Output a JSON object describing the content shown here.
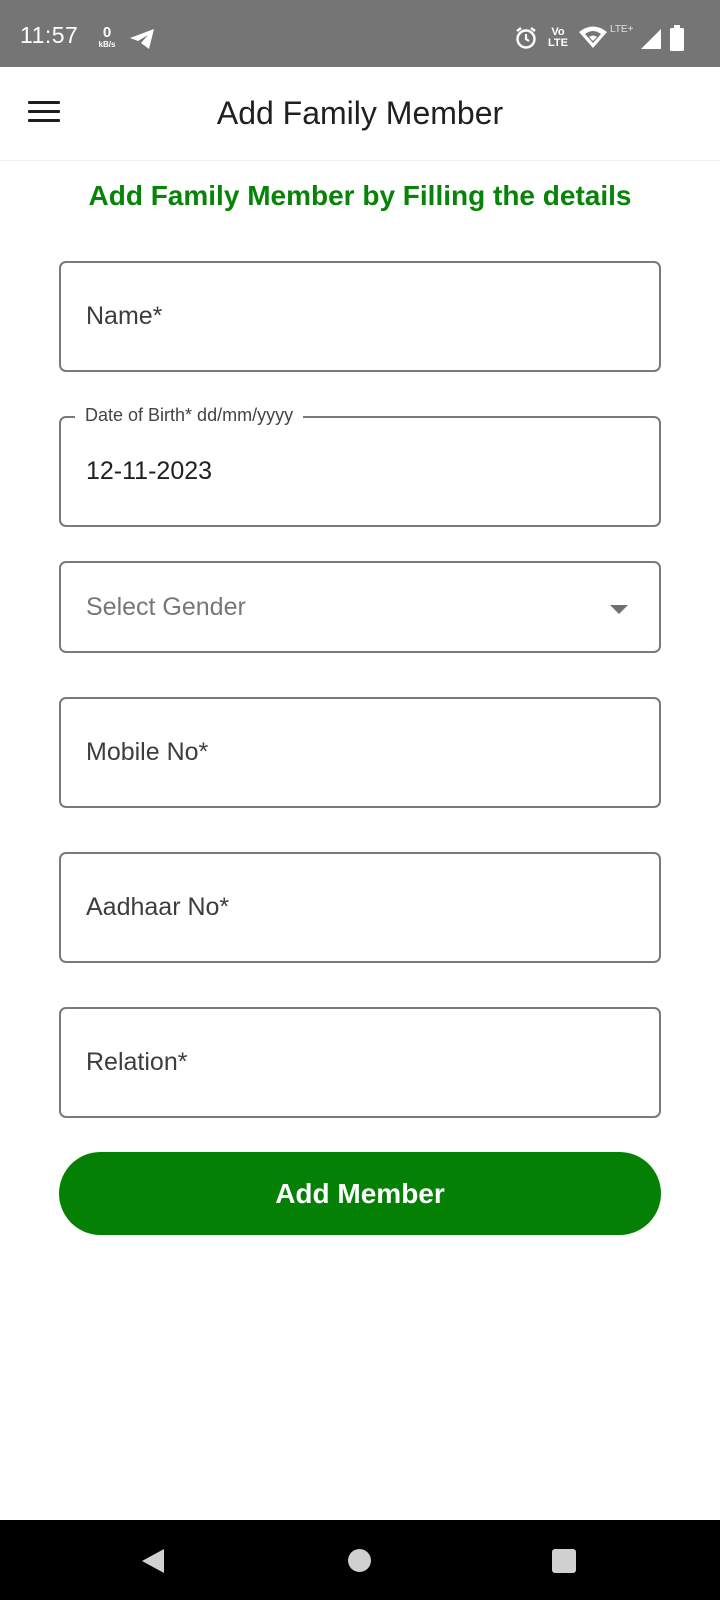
{
  "status_bar": {
    "time": "11:57",
    "net_speed_value": "0",
    "net_speed_unit": "kB/s",
    "volte_top": "Vo",
    "volte_bottom": "LTE",
    "lte_plus": "LTE+",
    "icons": [
      "telegram-icon",
      "alarm-icon",
      "volte-icon",
      "wifi-icon",
      "signal-icon",
      "battery-icon"
    ]
  },
  "app_bar": {
    "title": "Add Family Member",
    "menu_icon": "hamburger-menu-icon"
  },
  "form": {
    "subtitle": "Add Family Member by Filling the details",
    "name": {
      "placeholder": "Name*",
      "value": ""
    },
    "dob": {
      "label": "Date of Birth* dd/mm/yyyy",
      "value": "12-11-2023"
    },
    "gender": {
      "placeholder": "Select Gender",
      "icon": "dropdown-caret-icon"
    },
    "mobile": {
      "placeholder": "Mobile No*",
      "value": ""
    },
    "aadhaar": {
      "placeholder": "Aadhaar No*",
      "value": ""
    },
    "relation": {
      "placeholder": "Relation*",
      "value": ""
    },
    "submit_label": "Add Member"
  },
  "colors": {
    "accent_green": "#078307",
    "button_green": "#048104",
    "status_bar_bg": "#757575",
    "nav_bar_bg": "#000000",
    "field_border": "#7a7a7a"
  },
  "nav_bar": {
    "icons": [
      "back-icon",
      "home-icon",
      "recents-icon"
    ]
  }
}
